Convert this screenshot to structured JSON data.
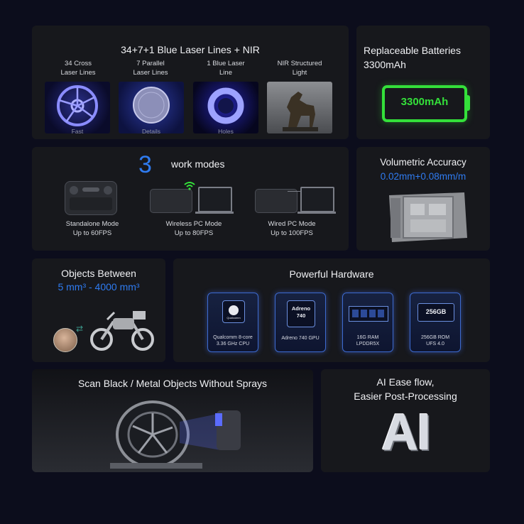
{
  "laser": {
    "title": "34+7+1 Blue Laser Lines + NIR",
    "items": [
      {
        "label": "34 Cross\nLaser Lines",
        "caption": "Fast"
      },
      {
        "label": "7 Parallel\nLaser Lines",
        "caption": "Details"
      },
      {
        "label": "1 Blue Laser\nLine",
        "caption": "Holes"
      },
      {
        "label": "NIR Structured\nLight",
        "caption": ""
      }
    ]
  },
  "battery": {
    "title_line1": "Replaceable Batteries",
    "title_line2": "3300mAh",
    "display": "3300mAh",
    "color": "#34e03a"
  },
  "modes": {
    "count": "3",
    "label": "work modes",
    "items": [
      {
        "name": "Standalone Mode",
        "fps": "Up to 60FPS"
      },
      {
        "name": "Wireless PC Mode",
        "fps": "Up to 80FPS"
      },
      {
        "name": "Wired PC Mode",
        "fps": "Up to 100FPS"
      }
    ]
  },
  "accuracy": {
    "title": "Volumetric Accuracy",
    "value": "0.02mm+0.08mm/m"
  },
  "objects": {
    "title": "Objects Between",
    "range": "5 mm³ - 4000 mm³"
  },
  "hardware": {
    "title": "Powerful Hardware",
    "chips": [
      {
        "icon_text": "Qualcomm",
        "caption": "Qualcomm 8-core\n3.36 GHz CPU"
      },
      {
        "icon_text": "Adreno\n740",
        "caption": "Adreno 740 GPU"
      },
      {
        "icon_text": "",
        "caption": "16G RAM\nLPDDR5X"
      },
      {
        "icon_text": "256GB",
        "caption": "256GB ROM\nUFS 4.0"
      }
    ]
  },
  "scan": {
    "title": "Scan Black / Metal Objects Without Sprays"
  },
  "ai": {
    "title_line1": "AI Ease flow,",
    "title_line2": "Easier Post-Processing",
    "logo_text": "AI"
  },
  "colors": {
    "accent_blue": "#2f7bf0",
    "battery_green": "#34e03a",
    "background": "#0c0d1c",
    "card": "#17181c"
  }
}
